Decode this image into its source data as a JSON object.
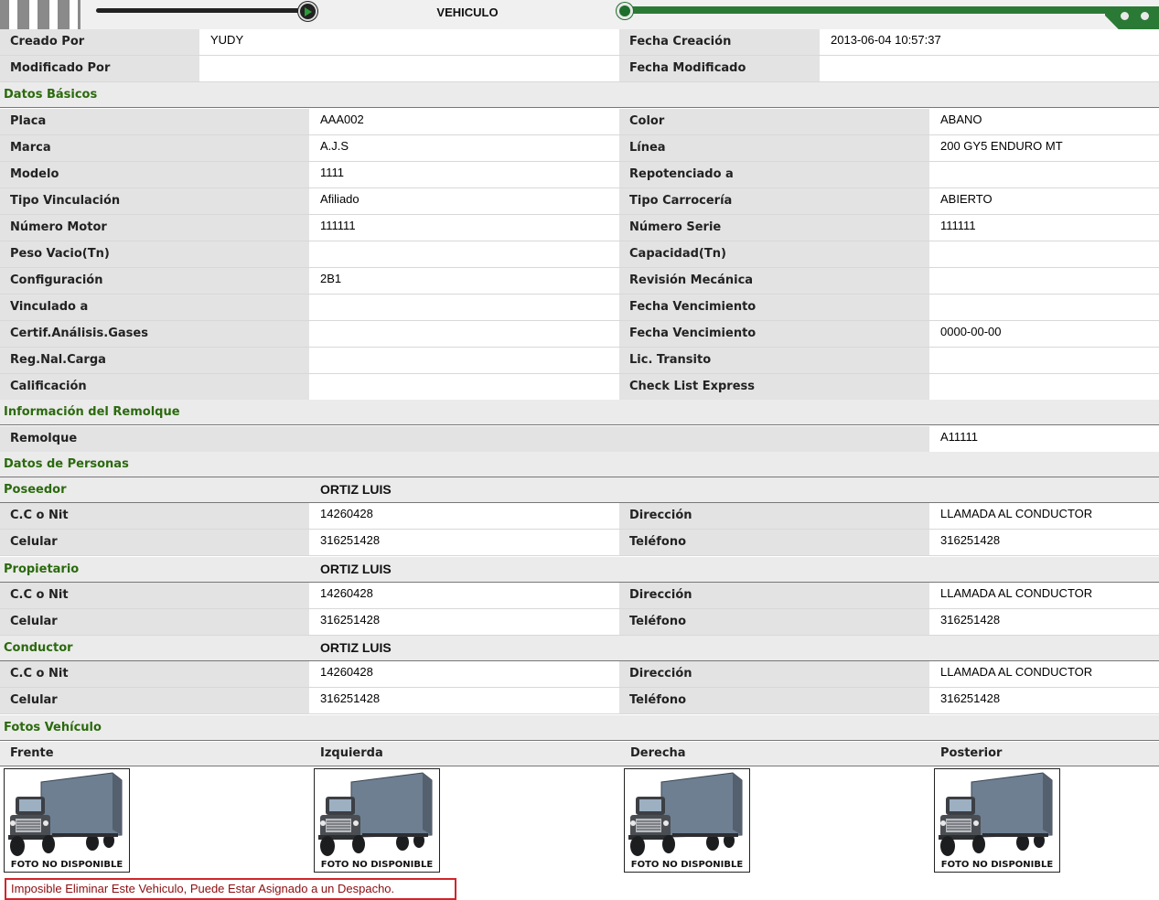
{
  "window": {
    "title": "VEHICULO"
  },
  "audit": {
    "created_by_label": "Creado Por",
    "created_by": "YUDY",
    "created_date_label": "Fecha Creación",
    "created_date": "2013-06-04 10:57:37",
    "modified_by_label": "Modificado Por",
    "modified_by": "",
    "modified_date_label": "Fecha Modificado",
    "modified_date": ""
  },
  "sections": {
    "basic": "Datos Básicos",
    "trailer": "Información del Remolque",
    "people": "Datos de Personas",
    "photos": "Fotos Vehículo"
  },
  "basic": [
    {
      "l1": "Placa",
      "v1": "AAA002",
      "l2": "Color",
      "v2": "ABANO"
    },
    {
      "l1": "Marca",
      "v1": "A.J.S",
      "l2": "Línea",
      "v2": "200 GY5 ENDURO MT"
    },
    {
      "l1": "Modelo",
      "v1": "1111",
      "l2": "Repotenciado a",
      "v2": ""
    },
    {
      "l1": "Tipo Vinculación",
      "v1": "Afiliado",
      "l2": "Tipo Carrocería",
      "v2": "ABIERTO"
    },
    {
      "l1": "Número Motor",
      "v1": "111111",
      "l2": "Número Serie",
      "v2": "111111"
    },
    {
      "l1": "Peso Vacio(Tn)",
      "v1": "",
      "l2": "Capacidad(Tn)",
      "v2": ""
    },
    {
      "l1": "Configuración",
      "v1": "2B1",
      "l2": "Revisión Mecánica",
      "v2": ""
    },
    {
      "l1": "Vinculado a",
      "v1": "",
      "l2": "Fecha Vencimiento",
      "v2": ""
    },
    {
      "l1": "Certif.Análisis.Gases",
      "v1": "",
      "l2": "Fecha Vencimiento",
      "v2": "0000-00-00"
    },
    {
      "l1": "Reg.Nal.Carga",
      "v1": "",
      "l2": "Lic. Transito",
      "v2": ""
    },
    {
      "l1": "Calificación",
      "v1": "",
      "l2": "Check List Express",
      "v2": ""
    }
  ],
  "trailer": {
    "label": "Remolque",
    "value": "A11111"
  },
  "persons": [
    {
      "role": "Poseedor",
      "name": "ORTIZ LUIS",
      "id_label": "C.C o Nit",
      "id": "14260428",
      "addr_label": "Dirección",
      "addr": "LLAMADA AL CONDUCTOR",
      "cell_label": "Celular",
      "cell": "316251428",
      "phone_label": "Teléfono",
      "phone": "316251428"
    },
    {
      "role": "Propietario",
      "name": "ORTIZ LUIS",
      "id_label": "C.C o Nit",
      "id": "14260428",
      "addr_label": "Dirección",
      "addr": "LLAMADA AL CONDUCTOR",
      "cell_label": "Celular",
      "cell": "316251428",
      "phone_label": "Teléfono",
      "phone": "316251428"
    },
    {
      "role": "Conductor",
      "name": "ORTIZ LUIS",
      "id_label": "C.C o Nit",
      "id": "14260428",
      "addr_label": "Dirección",
      "addr": "LLAMADA AL CONDUCTOR",
      "cell_label": "Celular",
      "cell": "316251428",
      "phone_label": "Teléfono",
      "phone": "316251428"
    }
  ],
  "photos": [
    {
      "label": "Frente",
      "caption": "FOTO NO DISPONIBLE"
    },
    {
      "label": "Izquierda",
      "caption": "FOTO NO DISPONIBLE"
    },
    {
      "label": "Derecha",
      "caption": "FOTO NO DISPONIBLE"
    },
    {
      "label": "Posterior",
      "caption": "FOTO NO DISPONIBLE"
    }
  ],
  "error_message": "Imposible Eliminar Este Vehiculo, Puede Estar Asignado a un Despacho.",
  "colors": {
    "section_title": "#2b6a0d",
    "label_bg": "#e3e3e3",
    "error_border": "#d0252b",
    "accent_green": "#2a7a36"
  }
}
